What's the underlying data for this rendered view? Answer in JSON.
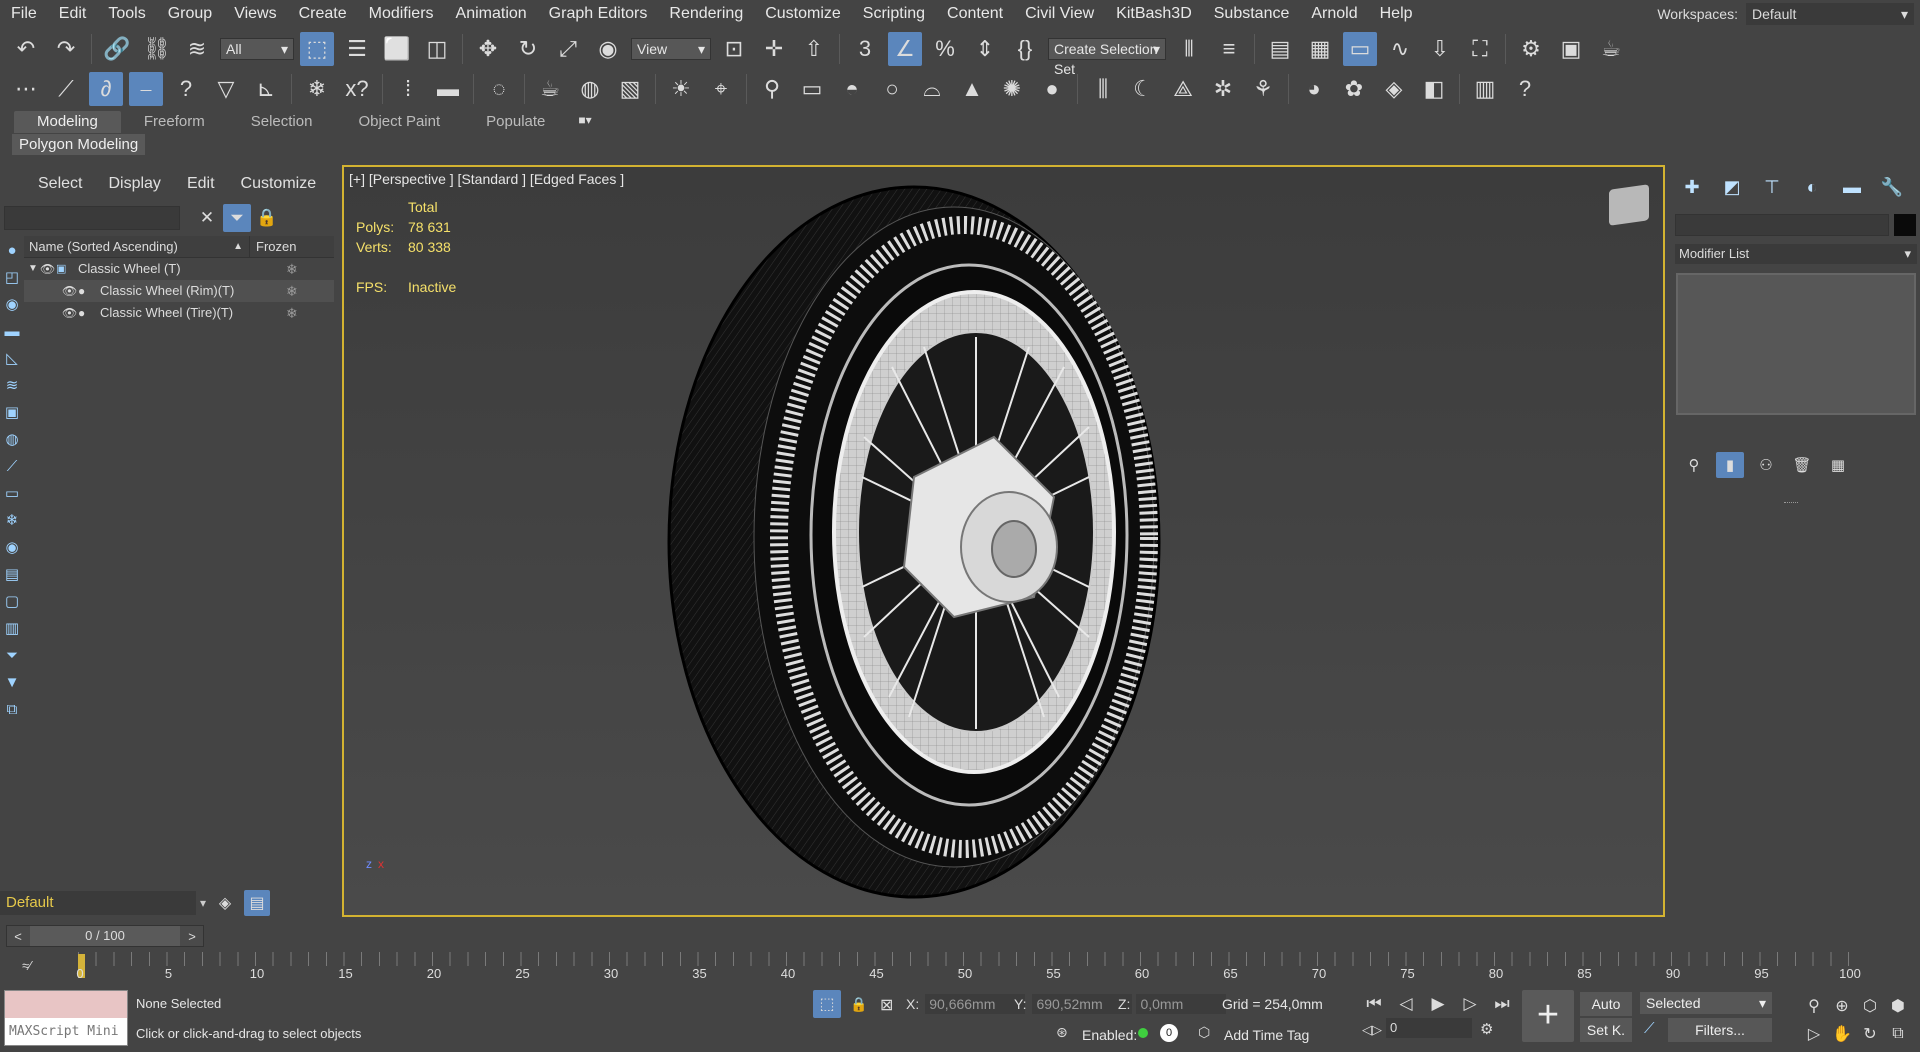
{
  "menu": [
    "File",
    "Edit",
    "Tools",
    "Group",
    "Views",
    "Create",
    "Modifiers",
    "Animation",
    "Graph Editors",
    "Rendering",
    "Customize",
    "Scripting",
    "Content",
    "Civil View",
    "KitBash3D",
    "Substance",
    "Arnold",
    "Help"
  ],
  "workspaces": {
    "label": "Workspaces:",
    "value": "Default"
  },
  "toolbar": {
    "filter_select": "All",
    "view_select": "View",
    "selection_set": "Create Selection Set"
  },
  "ribbon": {
    "tabs": [
      "Modeling",
      "Freeform",
      "Selection",
      "Object Paint",
      "Populate"
    ],
    "sub_tab": "Polygon Modeling"
  },
  "scene_explorer": {
    "menu": [
      "Select",
      "Display",
      "Edit",
      "Customize"
    ],
    "columns": {
      "name": "Name (Sorted Ascending)",
      "frozen": "Frozen"
    },
    "rows": [
      {
        "label": "Classic Wheel (T)"
      },
      {
        "label": "Classic Wheel (Rim)(T)"
      },
      {
        "label": "Classic Wheel (Tire)(T)"
      }
    ],
    "layer": "Default"
  },
  "viewport": {
    "label": "[+] [Perspective ] [Standard ] [Edged Faces ]",
    "stats": {
      "header": "Total",
      "polys_label": "Polys:",
      "polys": "78 631",
      "verts_label": "Verts:",
      "verts": "80 338",
      "fps_label": "FPS:",
      "fps": "Inactive"
    }
  },
  "command_panel": {
    "modifier_list": "Modifier List"
  },
  "timeline": {
    "frame": "0 / 100",
    "ticks": [
      "0",
      "5",
      "10",
      "15",
      "20",
      "25",
      "30",
      "35",
      "40",
      "45",
      "50",
      "55",
      "60",
      "65",
      "70",
      "75",
      "80",
      "85",
      "90",
      "95",
      "100"
    ]
  },
  "status": {
    "maxscript": "MAXScript Mini",
    "selection": "None Selected",
    "prompt": "Click or click-and-drag to select objects",
    "x_label": "X:",
    "x": "90,666mm",
    "y_label": "Y:",
    "y": "690,52mm",
    "z_label": "Z:",
    "z": "0,0mm",
    "grid": "Grid = 254,0mm",
    "enabled_label": "Enabled:",
    "add_time_tag": "Add Time Tag",
    "auto": "Auto",
    "set_key": "Set K.",
    "key_filter": "Selected",
    "filters": "Filters...",
    "frame_value": "0"
  },
  "colors": {
    "accent": "#5b86bc",
    "viewport_border": "#d3b331",
    "stats_text": "#f5e06a",
    "layer_text": "#e5c84a"
  }
}
